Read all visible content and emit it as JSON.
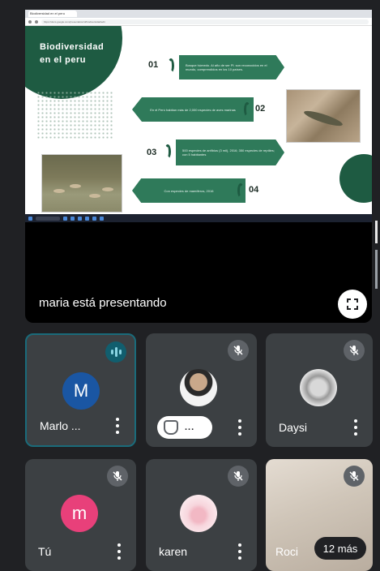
{
  "presentation": {
    "browser_tab": "Biodiversidad en el peru",
    "address": "https://docs.google.com/presentation/d/biodiversidad/edit",
    "slide": {
      "title_line1": "Biodiversidad",
      "title_line2": "en el peru",
      "items": [
        {
          "num": "01",
          "text": "Bosque húmedo. Al año de ser Pl. son reconocidos en el mundo, comprendidos en los 10 países."
        },
        {
          "num": "02",
          "text": "En el Perú habitan más de 2,000 especies de aves marinas"
        },
        {
          "num": "03",
          "text": "500 especies de anfibios (3 mil), 2016; 350 especies de reptiles; con 5 habitantes"
        },
        {
          "num": "04",
          "text": "Con especies de mamíferos, 2016"
        }
      ]
    },
    "presenter_text": "maria está presentando"
  },
  "participants": [
    {
      "id": "marlo",
      "name": "Marlo ...",
      "initial": "M",
      "avatar_color": "#1a56a3",
      "status": "speaking"
    },
    {
      "id": "raised",
      "name": "...",
      "status": "muted",
      "hand_raised": true
    },
    {
      "id": "daysi",
      "name": "Daysi",
      "status": "muted"
    },
    {
      "id": "tu",
      "name": "Tú",
      "initial": "m",
      "avatar_color": "#e8407a",
      "status": "muted"
    },
    {
      "id": "karen",
      "name": "karen",
      "status": "muted"
    },
    {
      "id": "rocio",
      "name": "Roci",
      "status": "muted"
    }
  ],
  "more_participants": "12 más",
  "icons": {
    "fullscreen": "fullscreen-icon",
    "mic_off": "mic-off-icon",
    "speaking": "audio-level-icon",
    "more": "more-vert-icon",
    "hand": "raised-hand-icon"
  },
  "colors": {
    "background": "#202124",
    "tile": "#3c4043",
    "active_border": "#1a6b7a",
    "slide_green": "#1e5b42"
  }
}
